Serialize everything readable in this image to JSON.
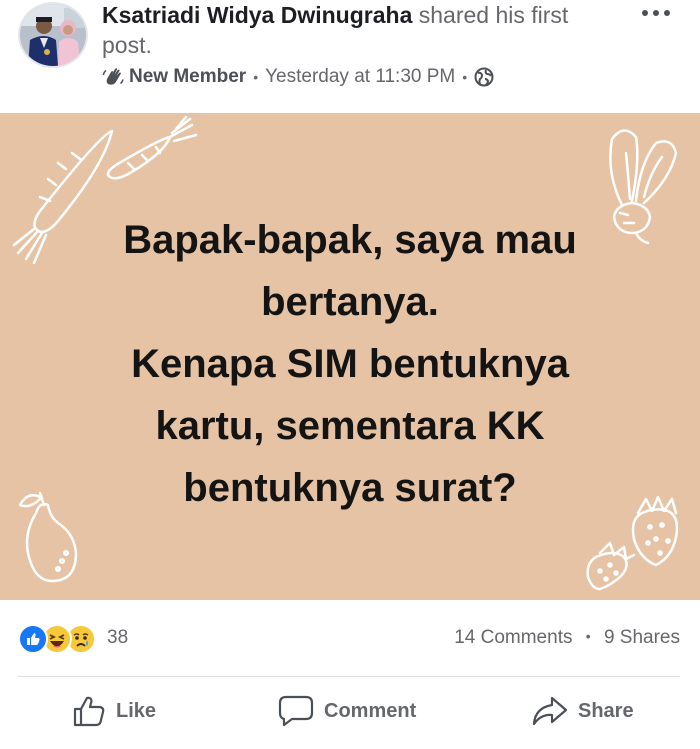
{
  "header": {
    "author": "Ksatriadi Widya Dwinugraha",
    "action_text": "shared his first post.",
    "badge_label": "New Member",
    "timestamp": "Yesterday at 11:30 PM",
    "privacy_icon": "globe-icon",
    "more_icon": "more-options-icon"
  },
  "post": {
    "background_color": "#e6c3a4",
    "lines": [
      "Bapak-bapak, saya mau",
      "bertanya.",
      "Kenapa SIM bentuknya",
      "kartu, sementara KK",
      "bentuknya surat?"
    ]
  },
  "reactions": {
    "icons": [
      "like-reaction-icon",
      "haha-reaction-icon",
      "sad-reaction-icon"
    ],
    "count": "38",
    "comments": "14 Comments",
    "shares": "9 Shares"
  },
  "actions": {
    "like_label": "Like",
    "comment_label": "Comment",
    "share_label": "Share"
  },
  "colors": {
    "like_blue": "#1877f2",
    "reaction_yellow": "#f7c83a",
    "secondary_text": "#65676b"
  }
}
